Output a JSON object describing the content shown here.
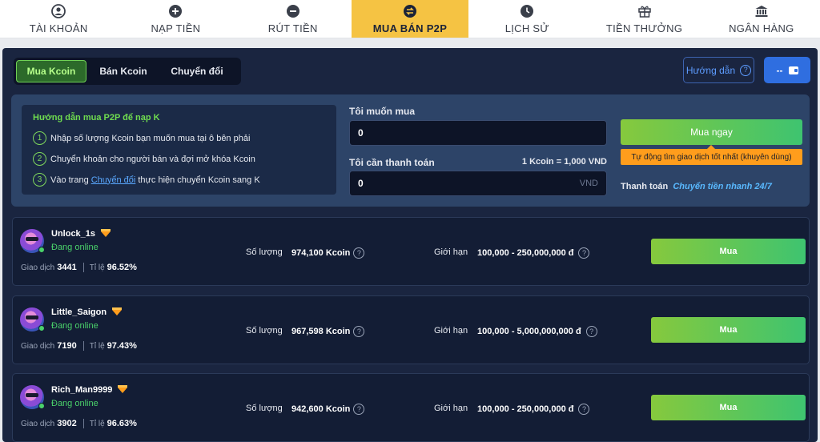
{
  "nav": {
    "items": [
      {
        "label": "TÀI KHOẢN",
        "icon": "account-icon"
      },
      {
        "label": "NẠP TIỀN",
        "icon": "plus-circle-icon"
      },
      {
        "label": "RÚT TIỀN",
        "icon": "minus-circle-icon"
      },
      {
        "label": "MUA BÁN P2P",
        "icon": "swap-icon"
      },
      {
        "label": "LỊCH SỬ",
        "icon": "clock-icon"
      },
      {
        "label": "TIỀN THƯỞNG",
        "icon": "gift-icon"
      },
      {
        "label": "NGÂN HÀNG",
        "icon": "bank-icon"
      }
    ],
    "active_index": 3
  },
  "tabs": {
    "buy": "Mua Kcoin",
    "sell": "Bán Kcoin",
    "convert": "Chuyển đổi",
    "active": "buy"
  },
  "guide_button": {
    "label": "Hướng dẫn",
    "icon": "question-icon"
  },
  "wallet_button": {
    "label": "--",
    "icon": "wallet-icon"
  },
  "howto": {
    "title": "Hướng dẫn mua P2P để nạp K",
    "steps": [
      {
        "num": "1",
        "text": "Nhập số lượng Kcoin bạn muốn mua tại ô bên phải"
      },
      {
        "num": "2",
        "text": "Chuyển khoản cho người bán và đợi mở khóa Kcoin"
      },
      {
        "num": "3",
        "text_before": "Vào trang",
        "link": "Chuyển đổi",
        "text_after": "thực hiện chuyển Kcoin sang K"
      }
    ]
  },
  "form": {
    "want_label": "Tôi muốn mua",
    "want_value": "0",
    "pay_label": "Tôi cần thanh toán",
    "rate": "1 Kcoin = 1,000 VND",
    "pay_value": "0",
    "pay_unit": "VND"
  },
  "buy_now": {
    "label": "Mua ngay",
    "tip": "Tự động tìm giao dịch tốt nhất (khuyên dùng)",
    "payment_label": "Thanh toán",
    "payment_value": "Chuyển tiền nhanh 24/7"
  },
  "sellers": [
    {
      "name": "Unlock_1s",
      "status": "Đang online",
      "trades_label": "Giao dịch",
      "trades": "3441",
      "rate_label": "Tỉ lệ",
      "rate": "96.52%",
      "qty_label": "Số lượng",
      "qty": "974,100 Kcoin",
      "limit_label": "Giới hạn",
      "limit": "100,000 - 250,000,000 đ",
      "button": "Mua"
    },
    {
      "name": "Little_Saigon",
      "status": "Đang online",
      "trades_label": "Giao dịch",
      "trades": "7190",
      "rate_label": "Tỉ lệ",
      "rate": "97.43%",
      "qty_label": "Số lượng",
      "qty": "967,598 Kcoin",
      "limit_label": "Giới hạn",
      "limit": "100,000 - 5,000,000,000 đ",
      "button": "Mua"
    },
    {
      "name": "Rich_Man9999",
      "status": "Đang online",
      "trades_label": "Giao dịch",
      "trades": "3902",
      "rate_label": "Tỉ lệ",
      "rate": "96.63%",
      "qty_label": "Số lượng",
      "qty": "942,600 Kcoin",
      "limit_label": "Giới hạn",
      "limit": "100,000 - 250,000,000 đ",
      "button": "Mua"
    }
  ],
  "colors": {
    "accent_yellow": "#f5c343",
    "green": "#4ad16a",
    "panel": "#1a2540",
    "orange": "#ff9d1c",
    "blue": "#2f6ee0"
  }
}
